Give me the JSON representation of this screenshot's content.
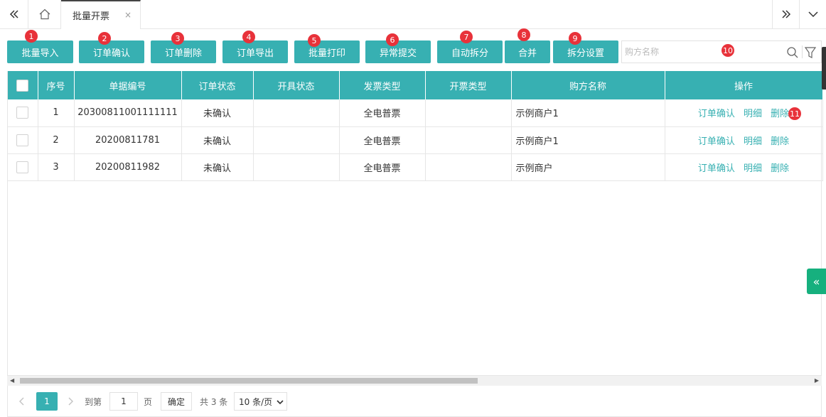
{
  "tabbar": {
    "active_tab": "批量开票",
    "close_glyph": "×",
    "icons": [
      "double-left-icon",
      "home-icon",
      "double-right-icon",
      "chevron-down-icon"
    ]
  },
  "toolbar": {
    "buttons": [
      {
        "label": "批量导入",
        "badge": "1"
      },
      {
        "label": "订单确认",
        "badge": "2"
      },
      {
        "label": "订单删除",
        "badge": "3"
      },
      {
        "label": "订单导出",
        "badge": "4"
      },
      {
        "label": "批量打印",
        "badge": "5"
      },
      {
        "label": "异常提交",
        "badge": "6"
      },
      {
        "label": "自动拆分",
        "badge": "7"
      },
      {
        "label": "合并",
        "badge": "8"
      },
      {
        "label": "拆分设置",
        "badge": "9"
      }
    ],
    "search_placeholder": "购方名称",
    "search_badge": "10"
  },
  "table": {
    "headers": [
      "序号",
      "单据编号",
      "订单状态",
      "开具状态",
      "发票类型",
      "开票类型",
      "购方名称",
      "操作"
    ],
    "rows": [
      {
        "index": "1",
        "doc_no": "20300811001111111",
        "order_status": "未确认",
        "issue_status": "",
        "invoice_type": "全电普票",
        "billing_type": "",
        "buyer": "示例商户1"
      },
      {
        "index": "2",
        "doc_no": "20200811781",
        "order_status": "未确认",
        "issue_status": "",
        "invoice_type": "全电普票",
        "billing_type": "",
        "buyer": "示例商户1"
      },
      {
        "index": "3",
        "doc_no": "20200811982",
        "order_status": "未确认",
        "issue_status": "",
        "invoice_type": "全电普票",
        "billing_type": "",
        "buyer": "示例商户"
      }
    ],
    "ops": {
      "confirm": "订单确认",
      "detail": "明细",
      "delete": "删除"
    },
    "ops_badge": "11"
  },
  "pager": {
    "current_page": "1",
    "goto_label": "到第",
    "goto_value": "1",
    "page_unit": "页",
    "confirm_label": "确定",
    "total_text": "共 3 条",
    "page_size": "10 条/页"
  },
  "side": {
    "collapse_glyph": "«"
  },
  "colors": {
    "primary": "#37b0b2",
    "badge": "#e8323a",
    "side_tab": "#16b07e"
  }
}
